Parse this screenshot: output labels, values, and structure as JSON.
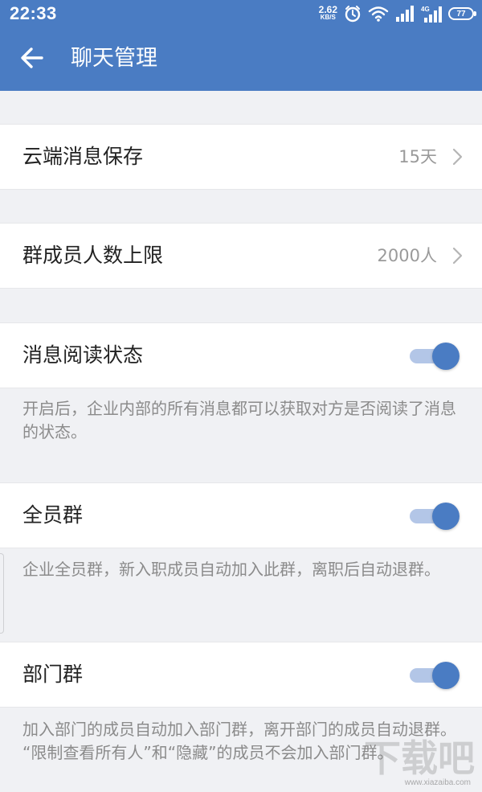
{
  "status_bar": {
    "time": "22:33",
    "net_speed_value": "2.62",
    "net_speed_unit": "KB/S",
    "network_type": "4G",
    "battery": "77"
  },
  "header": {
    "title": "聊天管理"
  },
  "settings": {
    "cloud_storage": {
      "label": "云端消息保存",
      "value": "15天"
    },
    "group_limit": {
      "label": "群成员人数上限",
      "value": "2000人"
    },
    "read_status": {
      "label": "消息阅读状态",
      "enabled": true,
      "description": "开启后，企业内部的所有消息都可以获取对方是否阅读了消息的状态。"
    },
    "all_staff_group": {
      "label": "全员群",
      "enabled": true,
      "description": "企业全员群，新入职成员自动加入此群，离职后自动退群。"
    },
    "department_group": {
      "label": "部门群",
      "enabled": true,
      "description_line1": "加入部门的成员自动加入部门群，离开部门的成员自动退群。",
      "description_line2": "“限制查看所有人”和“隐藏”的成员不会加入部门群。"
    }
  },
  "watermark": {
    "sub": "www.xiazaiba.com"
  },
  "colors": {
    "primary": "#4a7cc3",
    "toggle_track": "#b3c6e7",
    "background": "#f0f1f4"
  }
}
